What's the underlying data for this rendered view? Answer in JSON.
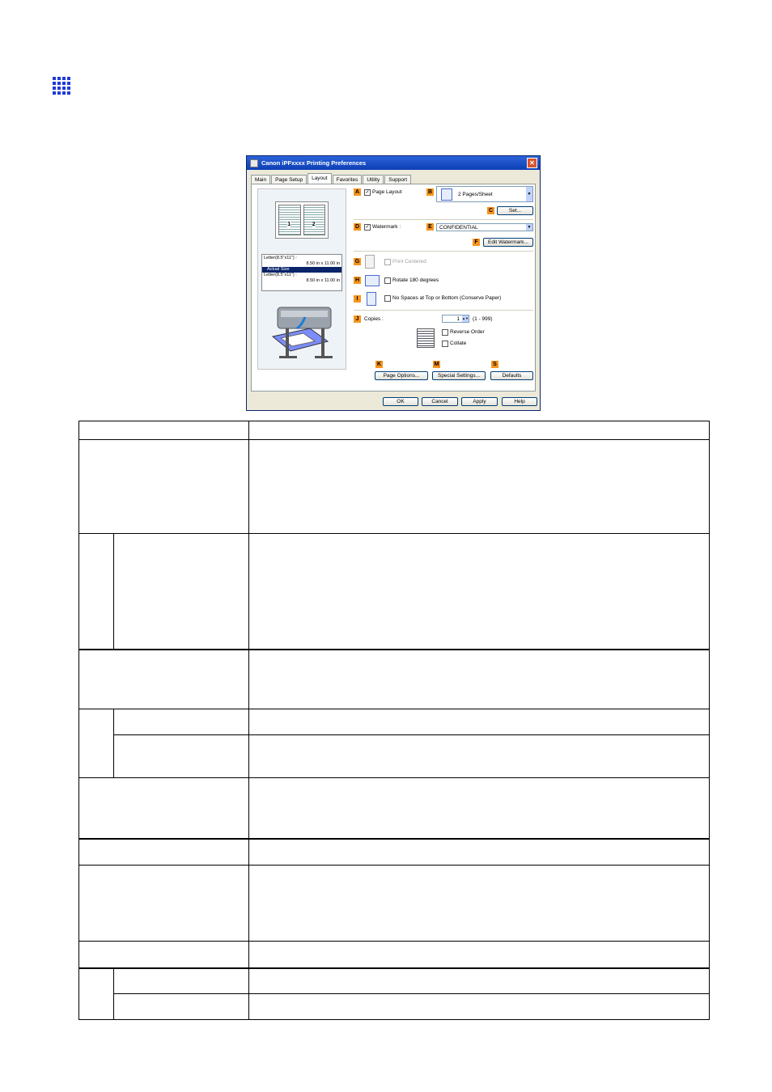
{
  "dialog": {
    "title": "Canon iPFxxxx Printing Preferences",
    "close": "✕",
    "tabs": [
      "Main",
      "Page Setup",
      "Layout",
      "Favorites",
      "Utility",
      "Support"
    ],
    "preview": {
      "page1": "1",
      "page2": "2",
      "size_line1": "Letter(8.5\"x11\") :",
      "size_line2": "8.50 in x 11.00 in",
      "actual_size": "Actual Size",
      "size_line3": "Letter(8.5\"x11\") :",
      "size_line4": "8.50 in x 11.00 in"
    },
    "labels": {
      "A": "A",
      "B": "B",
      "C": "C",
      "D": "D",
      "E": "E",
      "F": "F",
      "G": "G",
      "H": "H",
      "I": "I",
      "J": "J",
      "K": "K",
      "M": "M",
      "S": "S"
    },
    "page_layout": "Page Layout",
    "pages_per_sheet": "2 Pages/Sheet",
    "set_button": "Set...",
    "watermark": "Watermark :",
    "watermark_value": "CONFIDENTIAL",
    "edit_watermark": "Edit Watermark...",
    "print_centered": "Print Centered",
    "rotate": "Rotate 180 degrees",
    "no_spaces": "No Spaces at Top or Bottom (Conserve Paper)",
    "copies": "Copies :",
    "copies_value": "1",
    "copies_range": "(1 - 999)",
    "reverse_order": "Reverse Order",
    "collate": "Collate",
    "page_options": "Page Options...",
    "special_settings": "Special Settings...",
    "defaults": "Defaults",
    "ok": "OK",
    "cancel": "Cancel",
    "apply": "Apply",
    "help": "Help",
    "check": "✓",
    "arrow": "▼"
  }
}
